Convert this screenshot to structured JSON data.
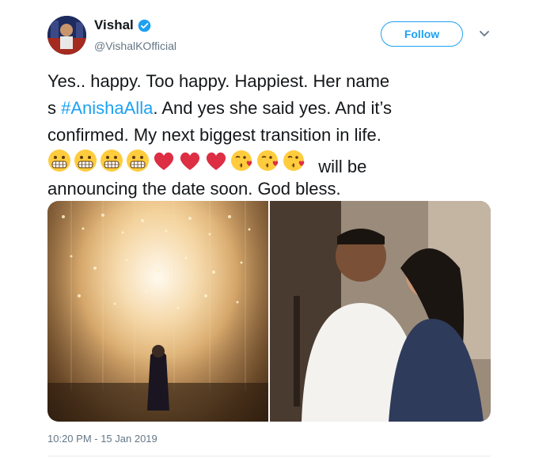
{
  "user": {
    "display_name": "Vishal",
    "handle": "@VishalKOfficial",
    "verified": true
  },
  "actions": {
    "follow_label": "Follow",
    "menu_icon": "chevron-down-icon"
  },
  "tweet": {
    "line1": "Yes.. happy. Too happy.  Happiest. Her name",
    "line2_prefix": "s ",
    "hashtag": "#AnishaAlla",
    "line2_suffix": ". And yes she said yes. And it’s",
    "line3": "confirmed. My next biggest transition in life.",
    "emojis": [
      "grimacing-face",
      "grimacing-face",
      "grimacing-face",
      "grimacing-face",
      "red-heart",
      "red-heart",
      "red-heart",
      "face-blowing-kiss",
      "face-blowing-kiss",
      "face-blowing-kiss"
    ],
    "line4_suffix": " will be",
    "line5": "announcing the date soon. God bless."
  },
  "media": {
    "count": 2
  },
  "timestamp": "10:20 PM - 15 Jan 2019",
  "colors": {
    "accent": "#1da1f2",
    "secondary_text": "#657786",
    "text": "#14171a"
  }
}
